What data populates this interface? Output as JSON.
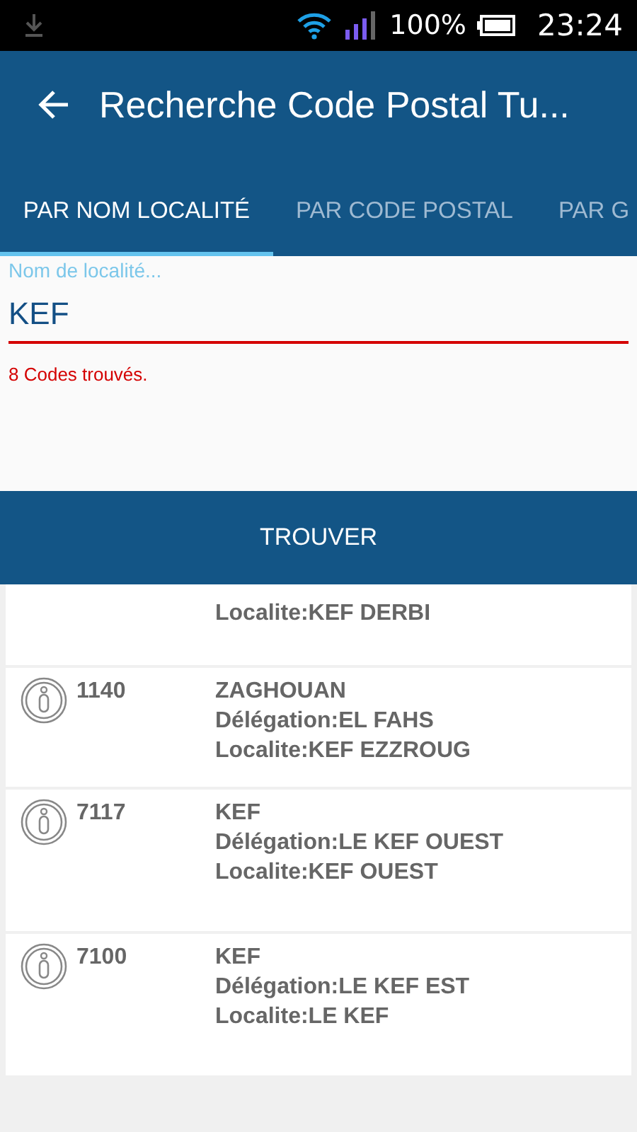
{
  "status_bar": {
    "battery": "100%",
    "time": "23:24"
  },
  "app_bar": {
    "title": "Recherche Code Postal Tu..."
  },
  "tabs": [
    {
      "label": "PAR NOM LOCALITÉ",
      "selected": true
    },
    {
      "label": "PAR CODE POSTAL",
      "selected": false
    },
    {
      "label": "PAR G",
      "selected": false
    }
  ],
  "search": {
    "floating_label": "Nom de localité...",
    "value": "KEF",
    "message": "8 Codes trouvés."
  },
  "find_button": "TROUVER",
  "results": [
    {
      "localite": "Localite:KEF DERBI"
    },
    {
      "code": "1140",
      "gouvernorat": "ZAGHOUAN",
      "delegation": "Délégation:EL FAHS",
      "localite": "Localite:KEF EZZROUG"
    },
    {
      "code": "7117",
      "gouvernorat": "KEF",
      "delegation": "Délégation:LE KEF OUEST",
      "localite": "Localite:KEF OUEST"
    },
    {
      "code": "7100",
      "gouvernorat": "KEF",
      "delegation": "Délégation:LE KEF EST",
      "localite": "Localite:LE KEF"
    }
  ]
}
